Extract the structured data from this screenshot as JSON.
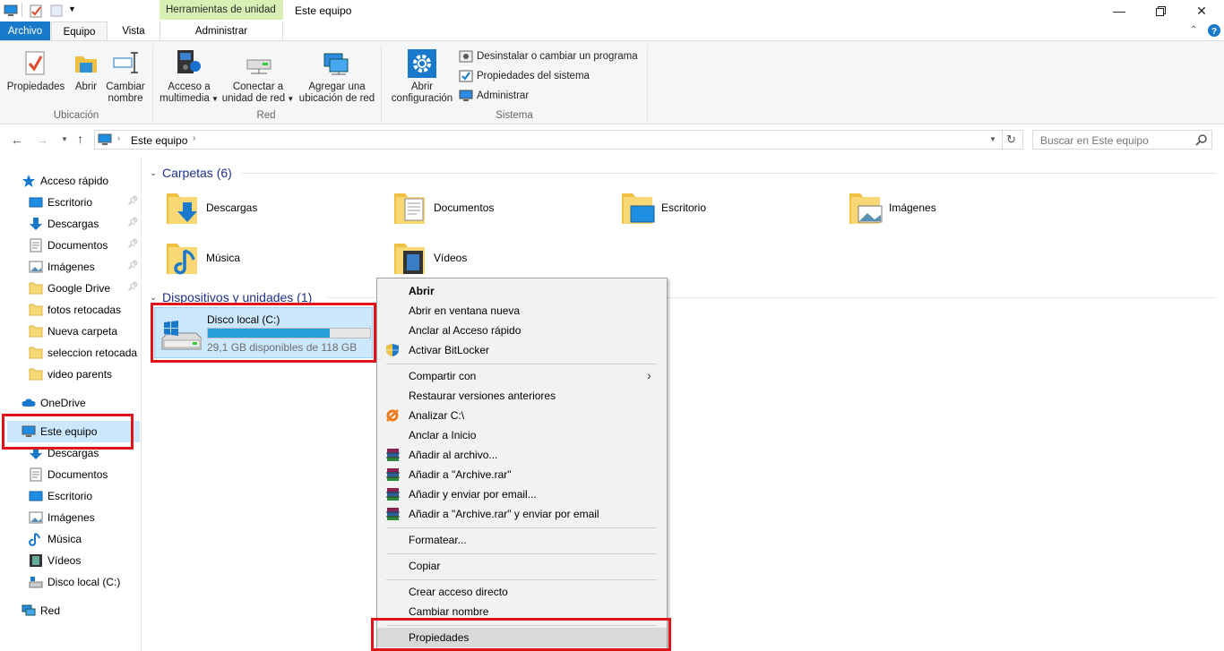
{
  "window": {
    "title": "Este equipo",
    "context_tab_header": "Herramientas de unidad"
  },
  "ribbon": {
    "tabs": [
      {
        "label": "Archivo"
      },
      {
        "label": "Equipo"
      },
      {
        "label": "Vista"
      },
      {
        "label": "Administrar"
      }
    ],
    "groups": {
      "ubicacion": {
        "label": "Ubicación",
        "propiedades": "Propiedades",
        "abrir": "Abrir",
        "cambiar_nombre_1": "Cambiar",
        "cambiar_nombre_2": "nombre"
      },
      "red": {
        "label": "Red",
        "acceso_1": "Acceso a",
        "acceso_2": "multimedia",
        "conectar_1": "Conectar a",
        "conectar_2": "unidad de red",
        "agregar_1": "Agregar una",
        "agregar_2": "ubicación de red"
      },
      "sistema": {
        "label": "Sistema",
        "abrir_conf_1": "Abrir",
        "abrir_conf_2": "configuración",
        "desinstalar": "Desinstalar o cambiar un programa",
        "propiedades_sistema": "Propiedades del sistema",
        "administrar": "Administrar"
      }
    }
  },
  "address": {
    "path": "Este equipo",
    "search_placeholder": "Buscar en Este equipo"
  },
  "nav": {
    "acceso_rapido": "Acceso rápido",
    "quick_items": [
      "Escritorio",
      "Descargas",
      "Documentos",
      "Imágenes",
      "Google Drive",
      "fotos retocadas",
      "Nueva carpeta",
      "seleccion retocada",
      "video parents"
    ],
    "onedrive": "OneDrive",
    "este_equipo": "Este equipo",
    "pc_items": [
      "Descargas",
      "Documentos",
      "Escritorio",
      "Imágenes",
      "Música",
      "Vídeos",
      "Disco local (C:)"
    ],
    "red": "Red"
  },
  "content": {
    "folders_header": "Carpetas (6)",
    "folders": [
      "Descargas",
      "Documentos",
      "Escritorio",
      "Imágenes",
      "Música",
      "Vídeos"
    ],
    "devices_header": "Dispositivos y unidades (1)",
    "drive": {
      "name": "Disco local (C:)",
      "free": "29,1 GB disponibles de 118 GB",
      "used_fraction": 0.753
    }
  },
  "context_menu": {
    "items": [
      "Abrir",
      "Abrir en ventana nueva",
      "Anclar al Acceso rápido",
      "Activar BitLocker",
      "Compartir con",
      "Restaurar versiones anteriores",
      "Analizar C:\\",
      "Anclar a Inicio",
      "Añadir al archivo...",
      "Añadir a \"Archive.rar\"",
      "Añadir y enviar por email...",
      "Añadir a \"Archive.rar\" y enviar por email",
      "Formatear...",
      "Copiar",
      "Crear acceso directo",
      "Cambiar nombre",
      "Propiedades"
    ]
  },
  "colors": {
    "accent": "#1979ca",
    "highlight": "#e0121b",
    "context_tab": "#d9f0b5",
    "drive_bar": "#26a0da"
  }
}
